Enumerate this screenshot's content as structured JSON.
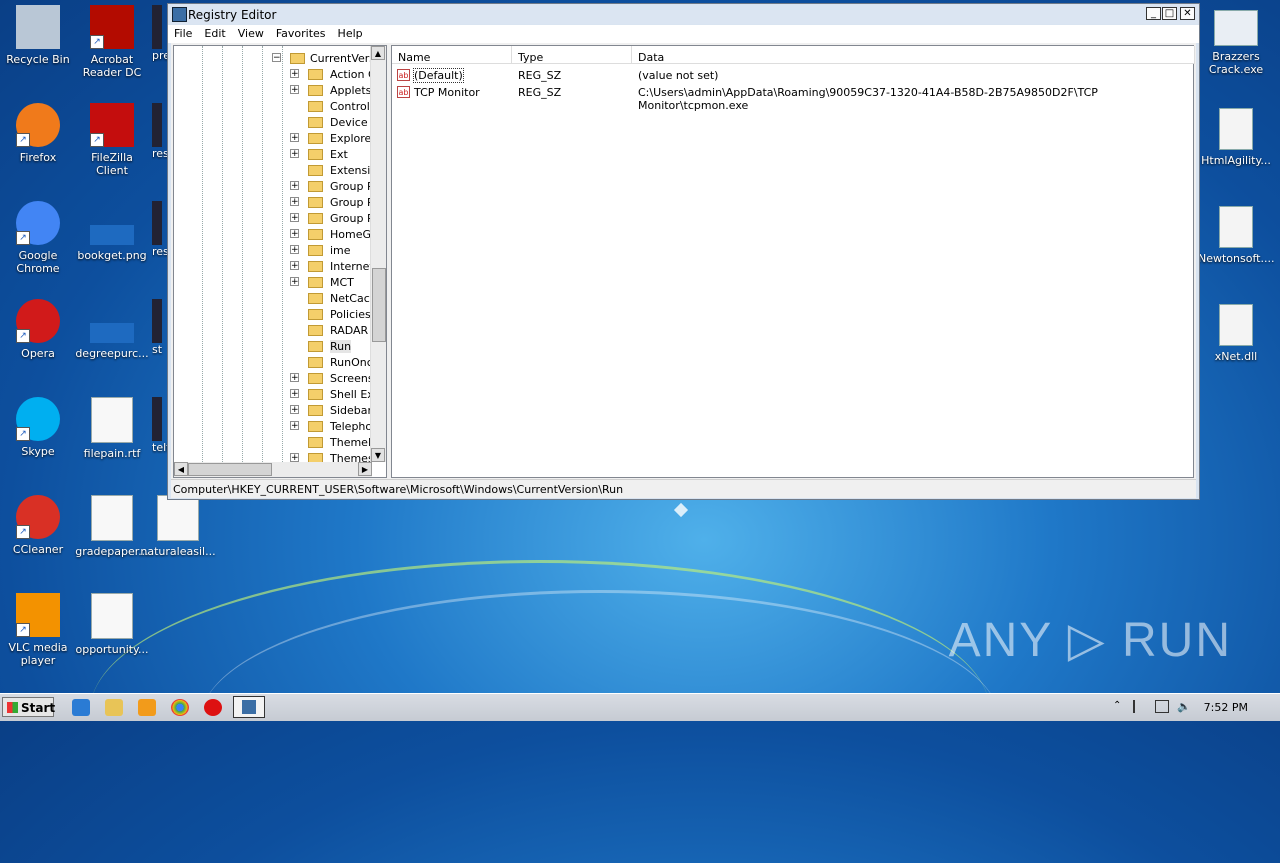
{
  "desktop": {
    "left_icons": [
      {
        "label": "Recycle Bin",
        "icon": "recycle-bin-icon"
      },
      {
        "label": "Acrobat Reader DC",
        "icon": "acrobat-icon"
      },
      {
        "label": "pre",
        "icon": "partial-icon"
      },
      {
        "label": "Firefox",
        "icon": "firefox-icon"
      },
      {
        "label": "FileZilla Client",
        "icon": "filezilla-icon"
      },
      {
        "label": "res",
        "icon": "partial-icon"
      },
      {
        "label": "Google Chrome",
        "icon": "chrome-icon"
      },
      {
        "label": "bookget.png",
        "icon": "image-file-icon"
      },
      {
        "label": "res",
        "icon": "partial-icon"
      },
      {
        "label": "Opera",
        "icon": "opera-icon"
      },
      {
        "label": "degreepurc...",
        "icon": "image-file-icon"
      },
      {
        "label": "st",
        "icon": "partial-icon"
      },
      {
        "label": "Skype",
        "icon": "skype-icon"
      },
      {
        "label": "filepain.rtf",
        "icon": "word-doc-icon"
      },
      {
        "label": "telt",
        "icon": "partial-icon"
      },
      {
        "label": "CCleaner",
        "icon": "ccleaner-icon"
      },
      {
        "label": "gradepaper...",
        "icon": "word-doc-icon"
      },
      {
        "label": "naturaleasil...",
        "icon": "word-doc-icon"
      },
      {
        "label": "VLC media player",
        "icon": "vlc-icon"
      },
      {
        "label": "opportunity...",
        "icon": "word-doc-icon"
      }
    ],
    "right_icons": [
      {
        "label": "Brazzers Crack.exe",
        "icon": "exe-icon"
      },
      {
        "label": "HtmlAgility...",
        "icon": "dll-icon"
      },
      {
        "label": "Newtonsoft....",
        "icon": "dll-icon"
      },
      {
        "label": "xNet.dll",
        "icon": "dll-icon"
      }
    ],
    "watermark": "ANY ▷ RUN"
  },
  "window": {
    "title": "Registry Editor",
    "menu": [
      "File",
      "Edit",
      "View",
      "Favorites",
      "Help"
    ],
    "tree_parent": "CurrentVers",
    "tree_items": [
      {
        "label": "Action C",
        "expandable": true
      },
      {
        "label": "Applets",
        "expandable": true
      },
      {
        "label": "Controls",
        "expandable": false
      },
      {
        "label": "Device I",
        "expandable": false
      },
      {
        "label": "Explorer",
        "expandable": true
      },
      {
        "label": "Ext",
        "expandable": true
      },
      {
        "label": "Extensic",
        "expandable": false
      },
      {
        "label": "Group Pc",
        "expandable": true
      },
      {
        "label": "Group Pc",
        "expandable": true
      },
      {
        "label": "Group Pc",
        "expandable": true
      },
      {
        "label": "HomeGr",
        "expandable": true
      },
      {
        "label": "ime",
        "expandable": true
      },
      {
        "label": "Internet",
        "expandable": true
      },
      {
        "label": "MCT",
        "expandable": true
      },
      {
        "label": "NetCach",
        "expandable": false
      },
      {
        "label": "Policies",
        "expandable": false
      },
      {
        "label": "RADAR",
        "expandable": false
      },
      {
        "label": "Run",
        "expandable": false,
        "selected": true
      },
      {
        "label": "RunOnce",
        "expandable": false
      },
      {
        "label": "Screens",
        "expandable": true
      },
      {
        "label": "Shell Ext",
        "expandable": true
      },
      {
        "label": "Sidebar",
        "expandable": true
      },
      {
        "label": "Telephor",
        "expandable": true
      },
      {
        "label": "ThemeM",
        "expandable": false
      },
      {
        "label": "Themes",
        "expandable": true
      }
    ],
    "columns": {
      "name": "Name",
      "type": "Type",
      "data": "Data"
    },
    "values": [
      {
        "name": "(Default)",
        "type": "REG_SZ",
        "data": "(value not set)"
      },
      {
        "name": "TCP Monitor",
        "type": "REG_SZ",
        "data": "C:\\Users\\admin\\AppData\\Roaming\\90059C37-1320-41A4-B58D-2B75A9850D2F\\TCP Monitor\\tcpmon.exe"
      }
    ],
    "status": "Computer\\HKEY_CURRENT_USER\\Software\\Microsoft\\Windows\\CurrentVersion\\Run"
  },
  "taskbar": {
    "start_label": "Start",
    "time": "7:52 PM"
  }
}
